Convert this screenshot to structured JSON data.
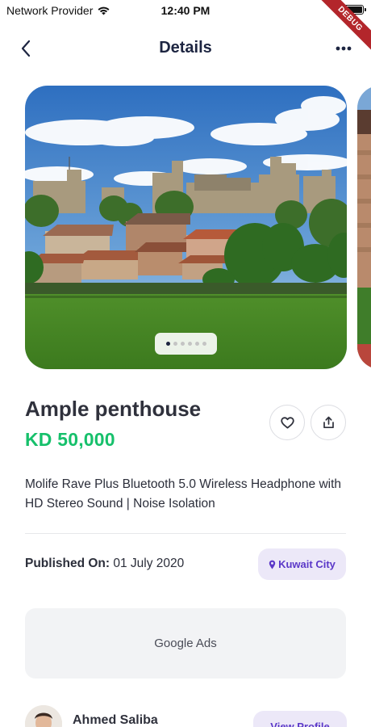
{
  "status_bar": {
    "carrier": "Network Provider",
    "time": "12:40 PM"
  },
  "debug_banner": "DEBUG",
  "header": {
    "title": "Details",
    "back_icon": "chevron-left-icon",
    "more_icon": "more-horizontal-icon"
  },
  "gallery": {
    "image_subject": "castle-town-landscape",
    "page_count": 6,
    "current_page": 1
  },
  "listing": {
    "title": "Ample penthouse",
    "price": "KD 50,000",
    "price_color": "#16c06b",
    "description": "Molife Rave Plus Bluetooth 5.0 Wireless Headphone with HD Stereo Sound | Noise Isolation",
    "published_label": "Published On:",
    "published_date": "01 July 2020",
    "location": "Kuwait City"
  },
  "actions": {
    "favorite_icon": "heart-outline-icon",
    "share_icon": "share-icon"
  },
  "ads": {
    "label": "Google Ads"
  },
  "seller": {
    "name": "Ahmed Saliba",
    "view_profile_label": "View Profile"
  },
  "colors": {
    "accent": "#5b38c8",
    "chip_bg": "#ece8f8",
    "title": "#1d2541"
  }
}
